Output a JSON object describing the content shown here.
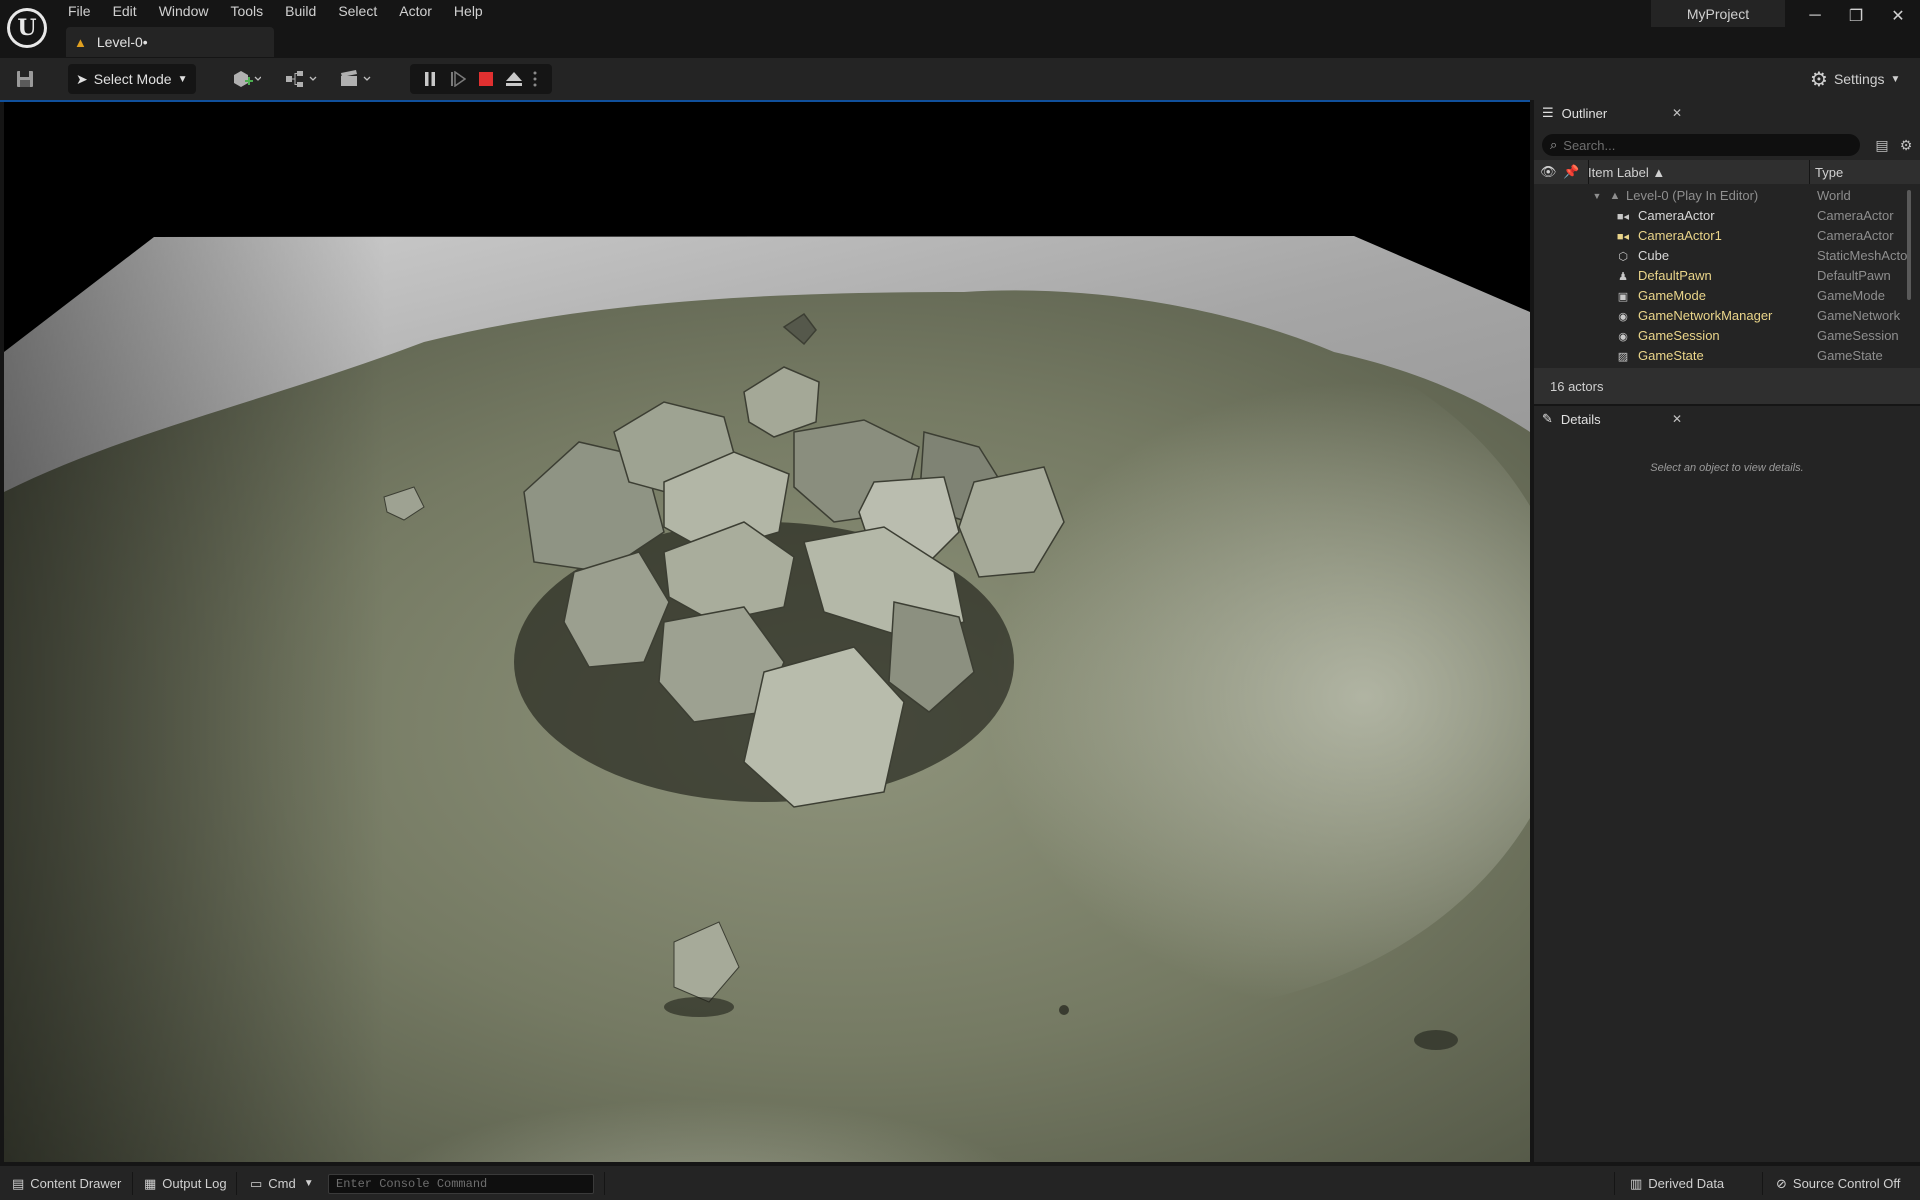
{
  "app": {
    "menu": [
      "File",
      "Edit",
      "Window",
      "Tools",
      "Build",
      "Select",
      "Actor",
      "Help"
    ],
    "level_tab": "Level-0•",
    "project_name": "MyProject",
    "window_controls": {
      "minimize": "─",
      "restore": "❐",
      "close": "✕"
    }
  },
  "toolbar": {
    "select_mode": "Select Mode",
    "settings": "Settings",
    "icons": [
      "save-icon",
      "add-actor-icon",
      "blueprint-icon",
      "cinematics-icon",
      "pause-icon",
      "skip-frame-icon",
      "stop-icon",
      "eject-icon",
      "more-options-icon"
    ],
    "stop_color": "#e03030"
  },
  "outliner": {
    "tab": "Outliner",
    "search_placeholder": "Search...",
    "col_label": "Item Label ▲",
    "col_type": "Type",
    "world_row": {
      "label": "Level-0 (Play In Editor)",
      "type": "World"
    },
    "rows": [
      {
        "label": "CameraActor",
        "type": "CameraActor",
        "icon": "camera-icon",
        "highlight": false
      },
      {
        "label": "CameraActor1",
        "type": "CameraActor",
        "icon": "camera-icon",
        "highlight": true
      },
      {
        "label": "Cube",
        "type": "StaticMeshActor",
        "icon": "static-mesh-icon",
        "highlight": false
      },
      {
        "label": "DefaultPawn",
        "type": "DefaultPawn",
        "icon": "pawn-icon",
        "highlight": true
      },
      {
        "label": "GameMode",
        "type": "GameMode",
        "icon": "game-mode-icon",
        "highlight": true
      },
      {
        "label": "GameNetworkManager",
        "type": "GameNetwork",
        "icon": "network-manager-icon",
        "highlight": true
      },
      {
        "label": "GameSession",
        "type": "GameSession",
        "icon": "game-session-icon",
        "highlight": true
      },
      {
        "label": "GameState",
        "type": "GameState",
        "icon": "game-state-icon",
        "highlight": true
      }
    ],
    "highlight_color": "#ead58a",
    "footer": "16 actors"
  },
  "details": {
    "tab": "Details",
    "empty_text": "Select an object to view details."
  },
  "statusbar": {
    "content_drawer": "Content Drawer",
    "output_log": "Output Log",
    "cmd": "Cmd",
    "console_placeholder": "Enter Console Command",
    "derived_data": "Derived Data",
    "source_control": "Source Control Off"
  }
}
